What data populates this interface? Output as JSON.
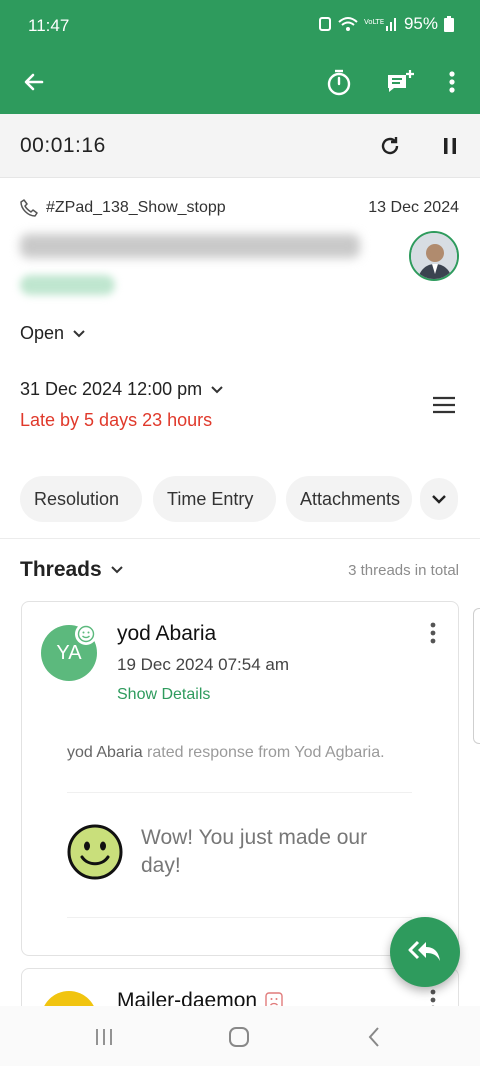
{
  "status_bar": {
    "time": "11:47",
    "battery": "95%"
  },
  "app_bar": {
    "back_icon": "arrow-left-icon",
    "timer_icon": "stopwatch-icon",
    "comment_icon": "add-comment-icon",
    "more_icon": "more-vertical-icon"
  },
  "timer": {
    "elapsed": "00:01:16"
  },
  "ticket": {
    "id": "#ZPad_138_Show_stopp",
    "created_date": "13 Dec 2024",
    "status": "Open",
    "due_date": "31 Dec 2024 12:00 pm",
    "late_text": "Late by 5 days 23 hours"
  },
  "tabs": [
    {
      "label": "Resolution"
    },
    {
      "label": "Time Entry"
    },
    {
      "label": "Attachments"
    }
  ],
  "threads": {
    "title": "Threads",
    "count_text": "3 threads in total",
    "items": [
      {
        "initials": "YA",
        "author": "yod Abaria",
        "timestamp": "19 Dec 2024 07:54 am",
        "details_link": "Show Details",
        "rated_author": "yod Abaria",
        "rated_text": " rated response from Yod Agbaria.",
        "feedback": "Wow! You just made our day!"
      },
      {
        "author": "Mailer-daemon"
      }
    ]
  },
  "colors": {
    "primary": "#2e9b5d",
    "late": "#e0392b",
    "smiley": "#c9df7b"
  }
}
